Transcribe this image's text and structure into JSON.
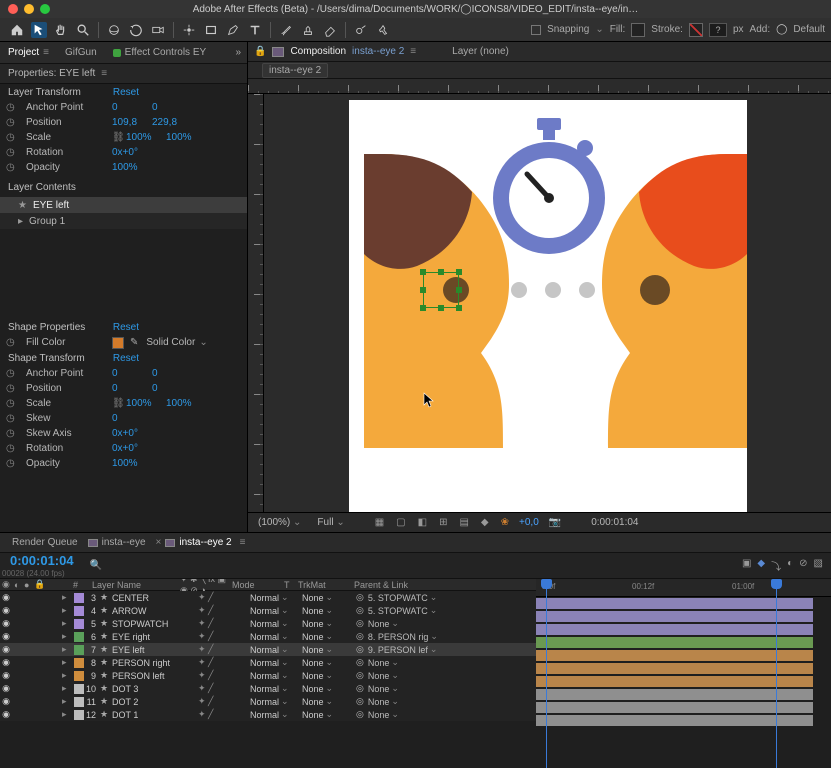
{
  "app": {
    "title": "Adobe After Effects (Beta) - /Users/dima/Documents/WORK/◯ICONS8/VIDEO_EDIT/insta--eye/in…"
  },
  "toolbar_right": {
    "snapping": "Snapping",
    "fill": "Fill:",
    "stroke": "Stroke:",
    "px_value": "?",
    "px": "px",
    "add": "Add:",
    "workspace": "Default"
  },
  "left_tabs": {
    "project": "Project",
    "gifgun": "GifGun",
    "effect_controls": "Effect Controls EY"
  },
  "props": {
    "header": "Properties: EYE left",
    "layer_transform": "Layer Transform",
    "reset": "Reset",
    "anchor": {
      "name": "Anchor Point",
      "v1": "0",
      "v2": "0"
    },
    "position": {
      "name": "Position",
      "v1": "109,8",
      "v2": "229,8"
    },
    "scale": {
      "name": "Scale",
      "v1": "100%",
      "v2": "100%"
    },
    "rotation": {
      "name": "Rotation",
      "v1": "0x+0°"
    },
    "opacity": {
      "name": "Opacity",
      "v1": "100%"
    },
    "layer_contents": "Layer Contents",
    "contents": [
      {
        "label": "EYE left",
        "type": "star",
        "selected": true
      },
      {
        "label": "Group 1",
        "type": "arrow",
        "selected": false
      }
    ],
    "shape_properties": "Shape Properties",
    "fill_color": {
      "name": "Fill Color",
      "type": "Solid Color"
    },
    "shape_transform": "Shape Transform",
    "st_anchor": {
      "name": "Anchor Point",
      "v1": "0",
      "v2": "0"
    },
    "st_position": {
      "name": "Position",
      "v1": "0",
      "v2": "0"
    },
    "st_scale": {
      "name": "Scale",
      "v1": "100%",
      "v2": "100%"
    },
    "st_skew": {
      "name": "Skew",
      "v1": "0"
    },
    "st_skew_axis": {
      "name": "Skew Axis",
      "v1": "0x+0°"
    },
    "st_rotation": {
      "name": "Rotation",
      "v1": "0x+0°"
    },
    "st_opacity": {
      "name": "Opacity",
      "v1": "100%"
    }
  },
  "viewer": {
    "comp_label": "Composition",
    "comp_name": "insta--eye 2",
    "layer_label": "Layer (none)",
    "breadcrumb": "insta--eye 2"
  },
  "viewer_foot": {
    "mag": "(100%)",
    "res": "Full",
    "exposure": "+0,0",
    "time": "0:00:01:04"
  },
  "timeline": {
    "render_queue": "Render Queue",
    "tabs": [
      "insta--eye",
      "insta--eye 2"
    ],
    "active_tab": 1,
    "time": "0:00:01:04",
    "subtime": "00028 (24.00 fps)",
    "ruler": {
      "marks": [
        ":00f",
        "00:12f",
        "01:00f"
      ]
    },
    "col_labels": {
      "idx": "#",
      "name": "Layer Name",
      "mode": "Mode",
      "t": "T",
      "trk": "TrkMat",
      "parent": "Parent & Link"
    },
    "mode_default": "Normal",
    "trk_default": "None",
    "layers": [
      {
        "idx": 3,
        "name": "CENTER",
        "color": "#a48ad6",
        "parent": "5. STOPWATC",
        "track": "#8b83b7"
      },
      {
        "idx": 4,
        "name": "ARROW",
        "color": "#a48ad6",
        "parent": "5. STOPWATC",
        "track": "#8b83b7"
      },
      {
        "idx": 5,
        "name": "STOPWATCH",
        "color": "#a48ad6",
        "parent": "None",
        "track": "#8b83b7"
      },
      {
        "idx": 6,
        "name": "EYE right",
        "color": "#5aa05a",
        "parent": "8. PERSON rig",
        "track": "#6a9a52"
      },
      {
        "idx": 7,
        "name": "EYE left",
        "color": "#5aa05a",
        "parent": "9. PERSON lef",
        "track": "#b9854a",
        "selected": true
      },
      {
        "idx": 8,
        "name": "PERSON right",
        "color": "#cf8d3d",
        "parent": "None",
        "track": "#b9854a"
      },
      {
        "idx": 9,
        "name": "PERSON left",
        "color": "#cf8d3d",
        "parent": "None",
        "track": "#b9854a"
      },
      {
        "idx": 10,
        "name": "DOT 3",
        "color": "#bdbdbd",
        "parent": "None",
        "track": "#8f8f8f"
      },
      {
        "idx": 11,
        "name": "DOT 2",
        "color": "#bdbdbd",
        "parent": "None",
        "track": "#8f8f8f"
      },
      {
        "idx": 12,
        "name": "DOT 1",
        "color": "#bdbdbd",
        "parent": "None",
        "track": "#8f8f8f"
      }
    ]
  }
}
